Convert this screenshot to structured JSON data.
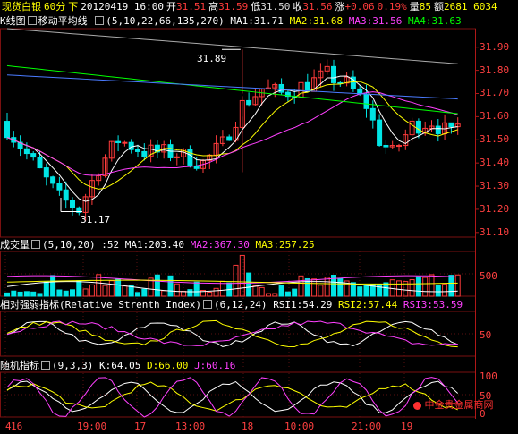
{
  "header": {
    "instrument": "现货白银",
    "period": "60分",
    "dir": "下",
    "datetime": "20120419 16:00",
    "open_label": "开",
    "open": "31.51",
    "high_label": "高",
    "high": "31.59",
    "low_label": "低",
    "low": "31.50",
    "close_label": "收",
    "close": "31.56",
    "chg_label": "涨",
    "chg": "+0.06",
    "pct": "0.19%",
    "vol_label": "量",
    "vol": "85",
    "amt_label": "额",
    "amt": "2681 6034"
  },
  "main": {
    "tab": "K线图",
    "ind_name": "移动平均线",
    "params": "(5,10,22,66,135,270)",
    "ma1": "MA1:31.71",
    "ma2": "MA2:31.68",
    "ma3": "MA3:31.56",
    "ma4": "MA4:31.63",
    "price_axis": [
      "31.90",
      "31.80",
      "31.70",
      "31.60",
      "31.50",
      "31.40",
      "31.30",
      "31.20",
      "31.10"
    ],
    "high_callout": "31.89",
    "low_callout": "31.17"
  },
  "volume": {
    "name": "成交量",
    "params": "(5,10,20)",
    "value": ":52",
    "ma1": "MA1:203.40",
    "ma2": "MA2:367.30",
    "ma3": "MA3:257.25",
    "axis": [
      "500"
    ]
  },
  "rsi": {
    "name": "相对强弱指标",
    "full": "(Relative Strenth Index)",
    "params": "(6,12,24)",
    "rsi1": "RSI1:54.29",
    "rsi2": "RSI2:57.44",
    "rsi3": "RSI3:53.59",
    "axis": [
      "50"
    ]
  },
  "kdj": {
    "name": "随机指标",
    "params": "(9,3,3)",
    "k": "K:64.05",
    "d": "D:66.00",
    "j": "J:60.16",
    "axis": [
      "100",
      "50",
      "0"
    ]
  },
  "time_axis": [
    "4",
    "16",
    "19:00",
    "17",
    "13:00",
    "18",
    "10:00",
    "21:00",
    "19"
  ],
  "watermark": "中金贵金属商网",
  "colors": {
    "up": "#ff3b3b",
    "down": "#00e5e5",
    "ma1": "#ffffff",
    "ma2": "#ffff00",
    "ma3": "#ff40ff",
    "ma4": "#00ff00",
    "ma5": "#4a7bff",
    "ma6": "#aaaaaa",
    "grid": "#7a1010"
  }
}
